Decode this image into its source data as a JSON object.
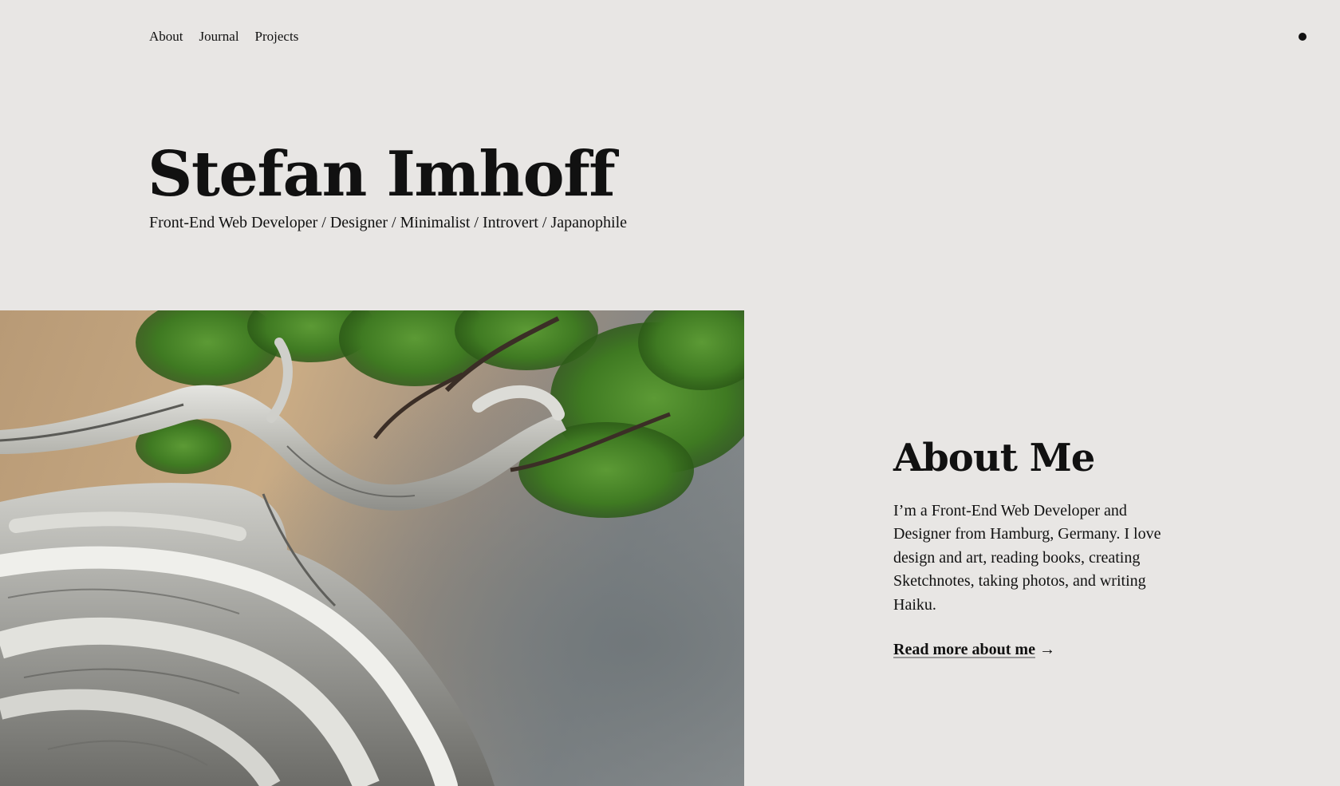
{
  "nav": {
    "items": [
      {
        "label": "About"
      },
      {
        "label": "Journal"
      },
      {
        "label": "Projects"
      }
    ]
  },
  "hero": {
    "title": "Stefan Imhoff",
    "subtitle": "Front-End Web Developer / Designer / Minimalist / Introvert / Japanophile"
  },
  "about": {
    "heading": "About Me",
    "text": "I’m a Front-End Web Developer and Designer from Hamburg, Germany. I love design and art, reading books, creating Sketchnotes, taking photos, and writing Haiku.",
    "link_label": "Read more about me",
    "link_arrow": "→"
  },
  "icons": {
    "theme_toggle": "dot-icon",
    "arrow": "arrow-right-icon"
  },
  "colors": {
    "background": "#e8e6e4",
    "text": "#111111"
  }
}
